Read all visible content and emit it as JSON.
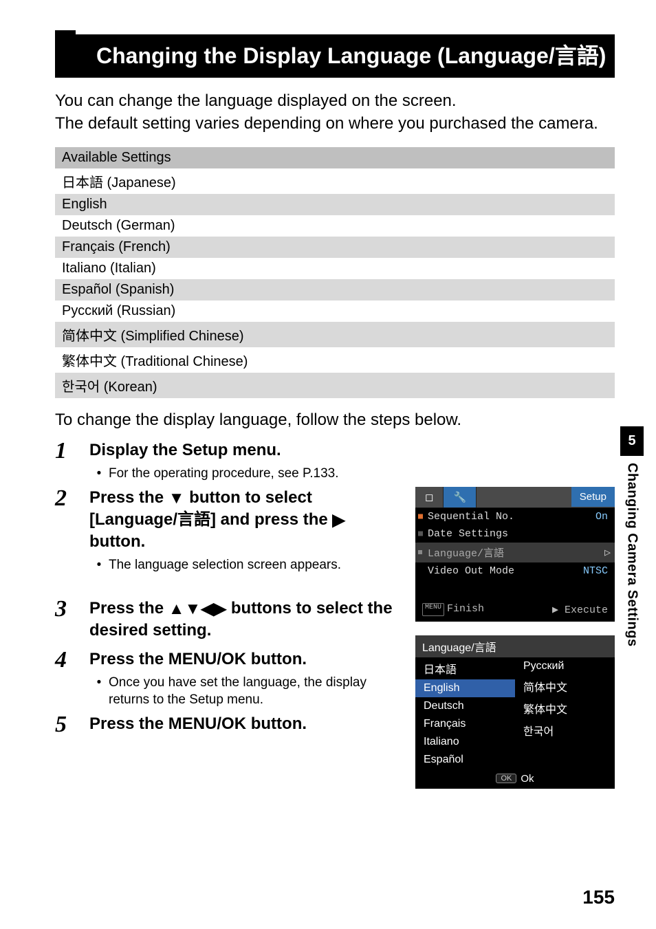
{
  "title": "Changing the Display Language (Language/言語)",
  "intro": "You can change the language displayed on the screen.\nThe default setting varies depending on where you purchased the camera.",
  "table": {
    "header": "Available Settings",
    "rows": [
      "日本語 (Japanese)",
      "English",
      "Deutsch (German)",
      "Français (French)",
      "Italiano (Italian)",
      "Español (Spanish)",
      "Русский (Russian)",
      "简体中文 (Simplified Chinese)",
      "繁体中文 (Traditional Chinese)",
      "한국어 (Korean)"
    ]
  },
  "below_table": "To change the display language, follow the steps below.",
  "steps": {
    "s1": {
      "num": "1",
      "title": "Display the Setup menu.",
      "bullet": "For the operating procedure, see P.133."
    },
    "s2": {
      "num": "2",
      "title_pre": "Press the ",
      "title_mid": " button to select [Language/言語] and press the ",
      "title_post": " button.",
      "bullet": "The language selection screen appears."
    },
    "s3": {
      "num": "3",
      "title_pre": "Press the ",
      "title_post": " buttons to select the desired setting."
    },
    "s4": {
      "num": "4",
      "title": "Press the MENU/OK button.",
      "bullet": "Once you have set the language, the display returns to the Setup menu."
    },
    "s5": {
      "num": "5",
      "title": "Press the MENU/OK button."
    }
  },
  "screenshot1": {
    "setup_label": "Setup",
    "rows": [
      {
        "label": "Sequential No.",
        "value": "On"
      },
      {
        "label": "Date Settings",
        "value": ""
      },
      {
        "label": "Language/言語",
        "value": ""
      },
      {
        "label": "Video Out Mode",
        "value": "NTSC"
      }
    ],
    "footer_left_prefix": "MENU",
    "footer_left": "Finish",
    "footer_right": "▶ Execute"
  },
  "screenshot2": {
    "header": "Language/言語",
    "col1": [
      "日本語",
      "English",
      "Deutsch",
      "Français",
      "Italiano",
      "Español"
    ],
    "col2": [
      "Русский",
      "简体中文",
      "繁体中文",
      "한국어",
      "",
      ""
    ],
    "selected": "English",
    "ok_btn": "OK",
    "ok_label": "Ok"
  },
  "side": {
    "num": "5",
    "label": "Changing Camera Settings"
  },
  "page_num": "155"
}
